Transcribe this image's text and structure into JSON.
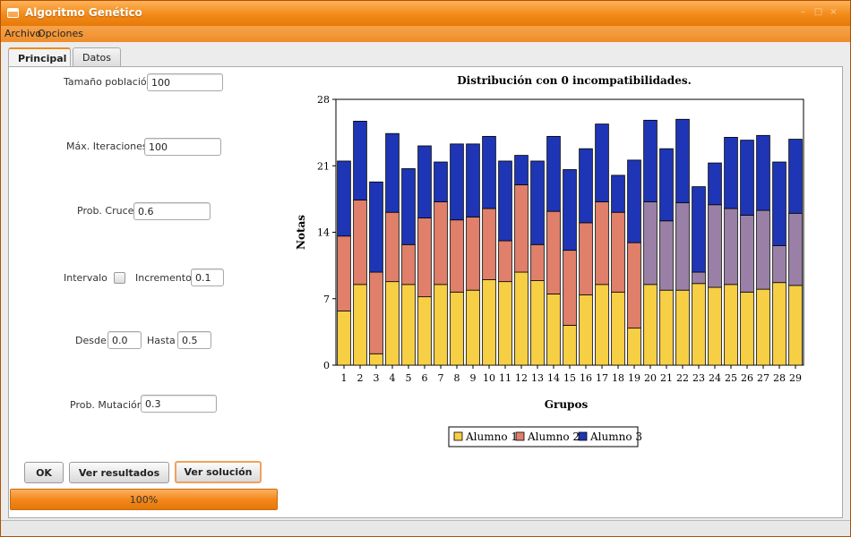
{
  "window": {
    "title": "Algoritmo Genético"
  },
  "menu": [
    "Archivo",
    "Opciones"
  ],
  "tabs": [
    {
      "label": "Principal",
      "active": true
    },
    {
      "label": "Datos",
      "active": false
    }
  ],
  "form": {
    "poblacion": {
      "label": "Tamaño población",
      "value": "100"
    },
    "iteraciones": {
      "label": "Máx. Iteraciones",
      "value": "100"
    },
    "cruce": {
      "label": "Prob. Cruce",
      "value": "0.6"
    },
    "intervalo": {
      "label": "Intervalo",
      "checked": false
    },
    "incremento": {
      "label": "Incremento",
      "value": "0.1"
    },
    "desde": {
      "label": "Desde",
      "value": "0.0"
    },
    "hasta": {
      "label": "Hasta",
      "value": "0.5"
    },
    "mutacion": {
      "label": "Prob. Mutación",
      "value": "0.3"
    }
  },
  "buttons": {
    "ok": "OK",
    "resultados": "Ver resultados",
    "solucion": "Ver solución"
  },
  "progress": {
    "value": 100,
    "label": "100%"
  },
  "colors": {
    "accent": "#f08a1e",
    "alumno1": "#f7cf44",
    "alumno2": "#e07f6a",
    "alumno3": "#1e35b5",
    "alumno2_alt": "#9a80a6"
  },
  "chart_data": {
    "type": "bar",
    "stacked": true,
    "title": "Distribución con 0 incompatibilidades.",
    "xlabel": "Grupos",
    "ylabel": "Notas",
    "ylim": [
      0,
      28
    ],
    "yticks": [
      0,
      7,
      14,
      21,
      28
    ],
    "categories": [
      "1",
      "2",
      "3",
      "4",
      "5",
      "6",
      "7",
      "8",
      "9",
      "10",
      "11",
      "12",
      "13",
      "14",
      "15",
      "16",
      "17",
      "18",
      "19",
      "20",
      "21",
      "22",
      "23",
      "24",
      "25",
      "26",
      "27",
      "28",
      "29"
    ],
    "series": [
      {
        "name": "Alumno 1",
        "values": [
          5.7,
          8.5,
          1.2,
          8.8,
          8.5,
          7.2,
          8.5,
          7.7,
          7.9,
          9.0,
          8.8,
          9.8,
          8.9,
          7.5,
          4.2,
          7.4,
          8.5,
          7.7,
          3.9,
          8.5,
          7.9,
          7.9,
          8.6,
          8.2,
          8.5,
          7.7,
          8.0,
          8.7,
          8.4
        ]
      },
      {
        "name": "Alumno 2",
        "values": [
          7.9,
          8.9,
          8.6,
          7.3,
          4.2,
          8.3,
          8.7,
          7.6,
          7.7,
          7.5,
          4.3,
          9.2,
          3.8,
          8.7,
          7.9,
          7.6,
          8.7,
          8.4,
          9.0,
          8.7,
          7.3,
          9.2,
          1.2,
          8.7,
          8.0,
          8.1,
          8.3,
          3.9,
          7.6
        ]
      },
      {
        "name": "Alumno 3",
        "values": [
          7.9,
          8.3,
          9.5,
          8.3,
          8.0,
          7.6,
          4.2,
          8.0,
          7.7,
          7.6,
          8.4,
          3.1,
          8.8,
          7.9,
          8.5,
          7.8,
          8.2,
          3.9,
          8.7,
          8.6,
          7.6,
          8.8,
          9.0,
          4.4,
          7.5,
          7.9,
          7.9,
          8.8,
          7.8
        ]
      }
    ],
    "legend_position": "bottom",
    "grid": false
  }
}
